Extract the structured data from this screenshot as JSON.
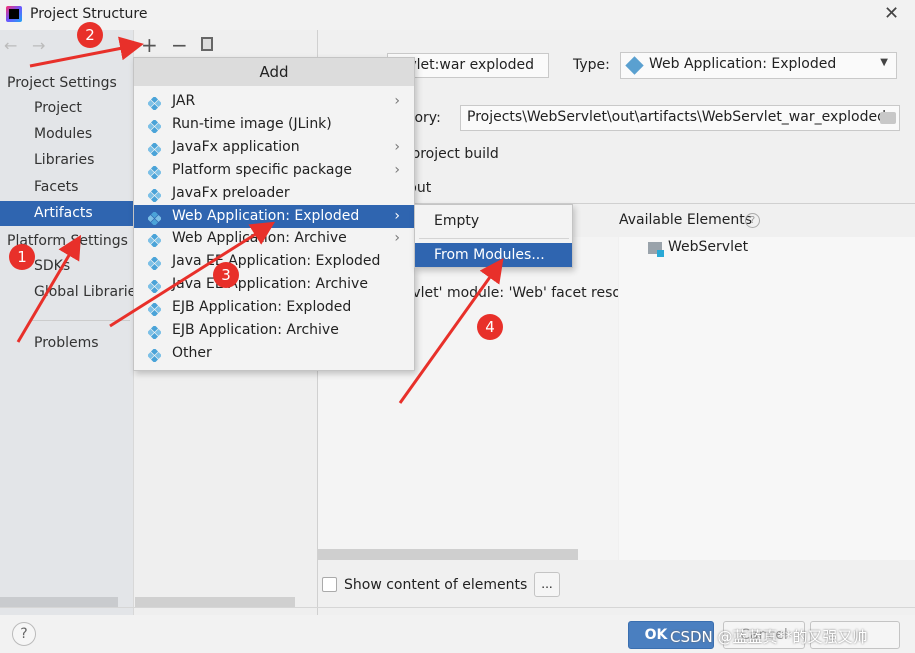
{
  "window": {
    "title": "Project Structure"
  },
  "toolbar": {
    "add": "+",
    "remove": "−"
  },
  "sidebar": {
    "project_settings": "Project Settings",
    "project_items": [
      "Project",
      "Modules",
      "Libraries",
      "Facets",
      "Artifacts"
    ],
    "platform_settings": "Platform Settings",
    "platform_items": [
      "SDKs",
      "Global Libraries"
    ],
    "problems": "Problems",
    "selected": "Artifacts"
  },
  "add_menu": {
    "title": "Add",
    "items": [
      {
        "label": "JAR",
        "submenu": true
      },
      {
        "label": "Run-time image (JLink)",
        "submenu": false
      },
      {
        "label": "JavaFx application",
        "submenu": true
      },
      {
        "label": "Platform specific package",
        "submenu": true
      },
      {
        "label": "JavaFx preloader",
        "submenu": false
      },
      {
        "label": "Web Application: Exploded",
        "submenu": true,
        "highlighted": true
      },
      {
        "label": "Web Application: Archive",
        "submenu": true
      },
      {
        "label": "Java EE Application: Exploded",
        "submenu": false
      },
      {
        "label": "Java EE Application: Archive",
        "submenu": false
      },
      {
        "label": "EJB Application: Exploded",
        "submenu": false
      },
      {
        "label": "EJB Application: Archive",
        "submenu": false
      },
      {
        "label": "Other",
        "submenu": false
      }
    ]
  },
  "submenu": {
    "items": [
      "Empty",
      "From Modules..."
    ],
    "highlighted": "From Modules..."
  },
  "artifact": {
    "name_value": "ervlet:war exploded",
    "type_label": "Type:",
    "type_value": "Web Application: Exploded",
    "output_label": "tory:",
    "output_value": "Projects\\WebServlet\\out\\artifacts\\WebServlet_war_exploded",
    "build_text": "n project build",
    "layout_text": "yout",
    "available_elements": "Available Elements",
    "module_tree_item": "WebServlet",
    "warning_text": "ervlet' module: 'Web' facet reso",
    "show_content": "Show content of elements",
    "ellipsis": "..."
  },
  "footer": {
    "help": "?",
    "ok": "OK",
    "cancel": "Cancel",
    "watermark": "CSDN @蓝蓝真**的又强又帅"
  },
  "annotations": [
    "1",
    "2",
    "3",
    "4"
  ],
  "colors": {
    "selection": "#2f65b0",
    "annotation": "#e8302a"
  }
}
